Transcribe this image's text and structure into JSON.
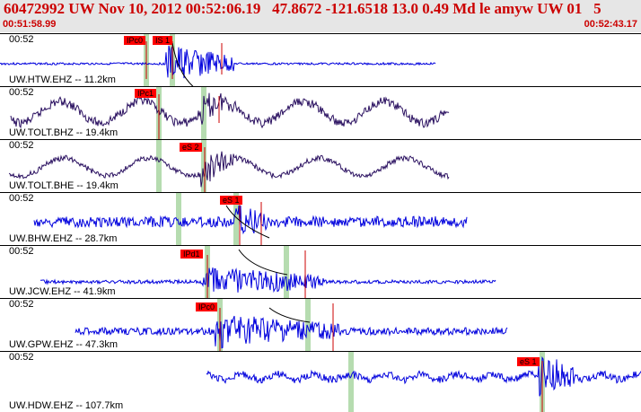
{
  "header": {
    "title": "60472992 UW Nov 10, 2012 00:52:06.19   47.8672 -121.6518 13.0 0.49 Md le amyw UW 01   5",
    "time_start": "00:51:58.99",
    "time_end": "00:52:43.17"
  },
  "colors": {
    "accent": "#cc0000",
    "header_bg": "#e6e6e6",
    "trace_blue": "#0000dd",
    "trace_purple": "#2a1060",
    "pick_red": "#ff0000",
    "window_green": "#b6dcb0"
  },
  "traces": [
    {
      "label": "UW.HTW.EHZ -- 11.2km",
      "time": "00:52",
      "color": "#0000dd",
      "picks": [
        "IPc0",
        "IS 1"
      ]
    },
    {
      "label": "UW.TOLT.BHZ -- 19.4km",
      "time": "00:52",
      "color": "#2a1060",
      "picks": [
        "IPc1"
      ]
    },
    {
      "label": "UW.TOLT.BHE -- 19.4km",
      "time": "00:52",
      "color": "#2a1060",
      "picks": [
        "eS 2"
      ]
    },
    {
      "label": "UW.BHW.EHZ -- 28.7km",
      "time": "00:52",
      "color": "#0000dd",
      "picks": [
        "eS 1"
      ]
    },
    {
      "label": "UW.JCW.EHZ -- 41.9km",
      "time": "00:52",
      "color": "#0000dd",
      "picks": [
        "IPd1"
      ]
    },
    {
      "label": "UW.GPW.EHZ -- 47.3km",
      "time": "00:52",
      "color": "#0000dd",
      "picks": [
        "IPc0"
      ]
    },
    {
      "label": "UW.HDW.EHZ -- 107.7km",
      "time": "00:52",
      "color": "#0000dd",
      "picks": [
        "eS 1"
      ]
    }
  ]
}
